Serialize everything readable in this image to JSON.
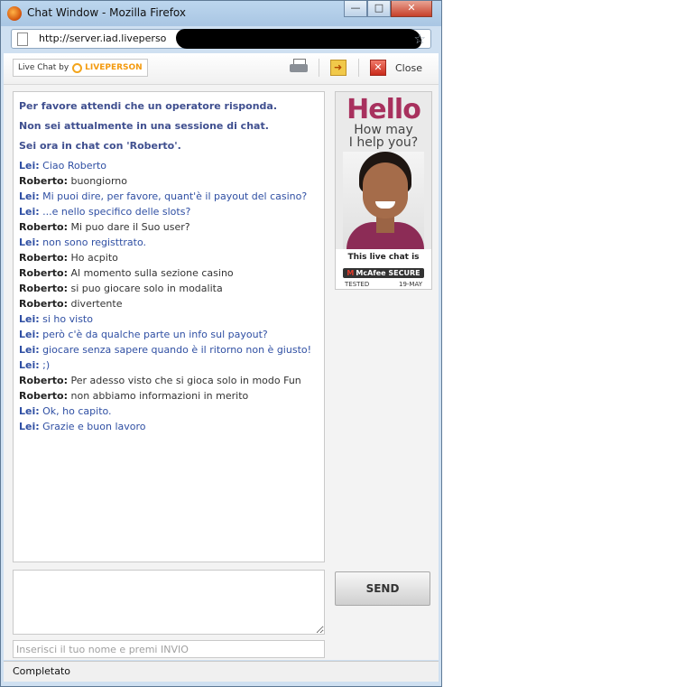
{
  "window": {
    "title": "Chat Window - Mozilla Firefox",
    "controls": {
      "minimize": "—",
      "maximize": "□",
      "close": "✕"
    }
  },
  "urlbar": {
    "url": "http://server.iad.liveperso"
  },
  "toolbar": {
    "badge_prefix": "Live Chat by",
    "badge_brand": "LIVEPERSON",
    "transcript_glyph": "➜",
    "close_glyph": "✕",
    "close_label": "Close"
  },
  "chat": {
    "system_messages": [
      "Per favore attendi che un operatore risponda.",
      "Non sei attualmente in una sessione di chat.",
      "Sei ora in chat con 'Roberto'."
    ],
    "messages": [
      {
        "who": "Lei:",
        "text": "Ciao Roberto",
        "role": "lei"
      },
      {
        "who": "Roberto:",
        "text": "buongiorno",
        "role": "op"
      },
      {
        "who": "Lei:",
        "text": "Mi puoi dire, per favore, quant'è il payout del casino?",
        "role": "lei"
      },
      {
        "who": "Lei:",
        "text": "...e nello specifico delle slots?",
        "role": "lei"
      },
      {
        "who": "Roberto:",
        "text": "Mi puo dare il Suo user?",
        "role": "op"
      },
      {
        "who": "Lei:",
        "text": "non sono registtrato.",
        "role": "lei"
      },
      {
        "who": "Roberto:",
        "text": "Ho acpito",
        "role": "op"
      },
      {
        "who": "Roberto:",
        "text": "Al momento sulla sezione casino",
        "role": "op"
      },
      {
        "who": "Roberto:",
        "text": "si puo giocare solo in modalita",
        "role": "op"
      },
      {
        "who": "Roberto:",
        "text": "divertente",
        "role": "op"
      },
      {
        "who": "Lei:",
        "text": "si ho visto",
        "role": "lei"
      },
      {
        "who": "Lei:",
        "text": "però c'è da qualche parte un info sul payout?",
        "role": "lei"
      },
      {
        "who": "Lei:",
        "text": "giocare senza sapere quando è il ritorno non è giusto!",
        "role": "lei"
      },
      {
        "who": "Lei:",
        "text": ";)",
        "role": "lei"
      },
      {
        "who": "Roberto:",
        "text": "Per adesso visto che si gioca solo in modo Fun",
        "role": "op"
      },
      {
        "who": "Roberto:",
        "text": "non abbiamo informazioni in merito",
        "role": "op"
      },
      {
        "who": "Lei:",
        "text": "Ok, ho capito.",
        "role": "lei"
      },
      {
        "who": "Lei:",
        "text": "Grazie e buon lavoro",
        "role": "lei"
      }
    ]
  },
  "ad": {
    "hello": "Hello",
    "line1": "How may",
    "line2": "I help you?",
    "badge_line": "This live chat is",
    "mcafee_m": "M",
    "mcafee_label": "McAfee SECURE",
    "tested_label": "TESTED",
    "tested_date": "19-MAY"
  },
  "composer": {
    "message_value": "",
    "send_label": "SEND",
    "name_placeholder": "Inserisci il tuo nome e premi INVIO"
  },
  "status": {
    "text": "Completato"
  },
  "colors": {
    "lei_text": "#2f4fa3",
    "system_text": "#3f4f8f",
    "ad_hello": "#a8315e"
  }
}
